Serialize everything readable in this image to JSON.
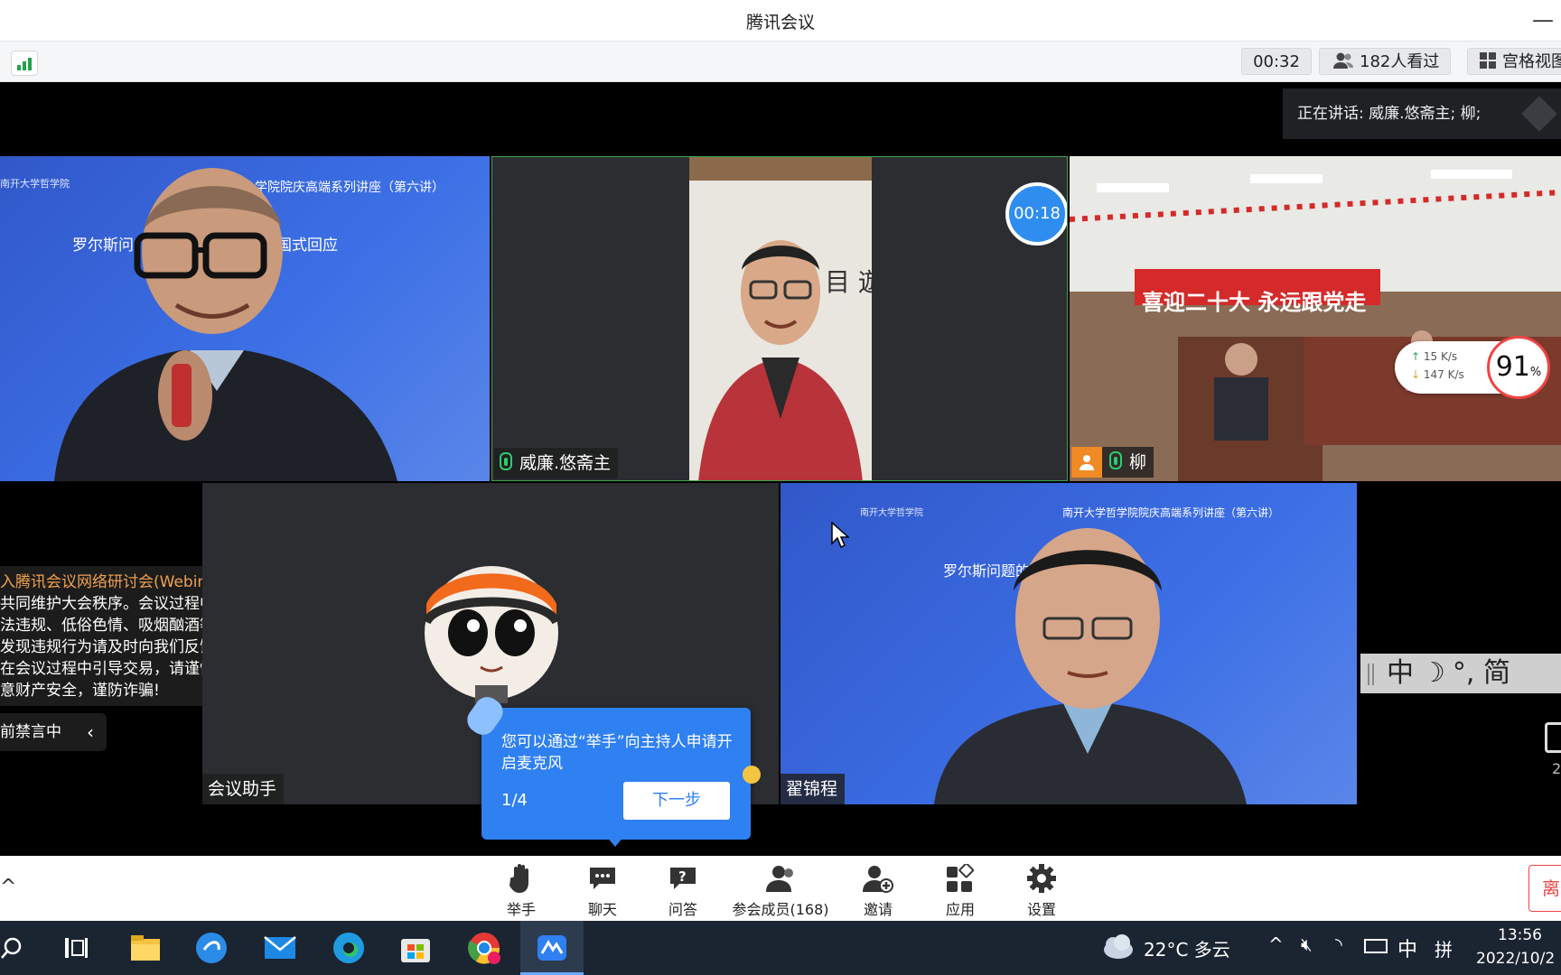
{
  "window": {
    "title": "腾讯会议"
  },
  "infobar": {
    "timer": "00:32",
    "viewers": "182人看过",
    "view_mode": "宫格视图"
  },
  "speaking": {
    "text": "正在讲话: 威廉.悠斋主; 柳;"
  },
  "tiles": {
    "t2": {
      "name": "威廉.悠斋主",
      "timer": "00:18"
    },
    "t3": {
      "name": "柳",
      "banner": "喜迎二十大 永远跟党走",
      "upload": "15  K/s",
      "download": "147 K/s",
      "cpu": "91",
      "cpu_unit": "%"
    },
    "t4": {
      "name": "会议助手"
    },
    "t5": {
      "name": "翟锦程",
      "school": "南开大学哲学院",
      "series": "南开大学哲学院院庆高端系列讲座（第六讲）",
      "talk_title": "罗尔斯问题的问题与中国式回应"
    },
    "t1": {
      "school": "南开大学哲学院",
      "series": "学院院庆高端系列讲座（第六讲）",
      "talk_title": "罗尔斯问",
      "talk_title2": "国式回应"
    }
  },
  "notice": {
    "line1": "入腾讯会议网络研讨会(Webinar)!",
    "line2": "共同维护大会秩序。会议过程中禁止",
    "line3": "法违规、低俗色情、吸烟酗酒等内",
    "line4": "发现违规行为请及时向我们反馈。如",
    "line5": "在会议过程中引导交易，请谨慎判",
    "line6": "意财产安全，谨防诈骗!",
    "mute_status": "前禁言中"
  },
  "tooltip": {
    "text": "您可以通过“举手”向主持人申请开启麦克风",
    "page": "1/4",
    "next_label": "下一步"
  },
  "ime": {
    "mode": "中",
    "punct": "°,",
    "simp": "简"
  },
  "toolbar": {
    "raise_hand": "举手",
    "chat": "聊天",
    "qa": "问答",
    "members": "参会成员(168)",
    "invite": "邀请",
    "apps": "应用",
    "settings": "设置",
    "leave": "离"
  },
  "taskbar": {
    "weather": "22°C  多云",
    "ime": "中",
    "time": "13:56",
    "date": "2022/10/2"
  }
}
